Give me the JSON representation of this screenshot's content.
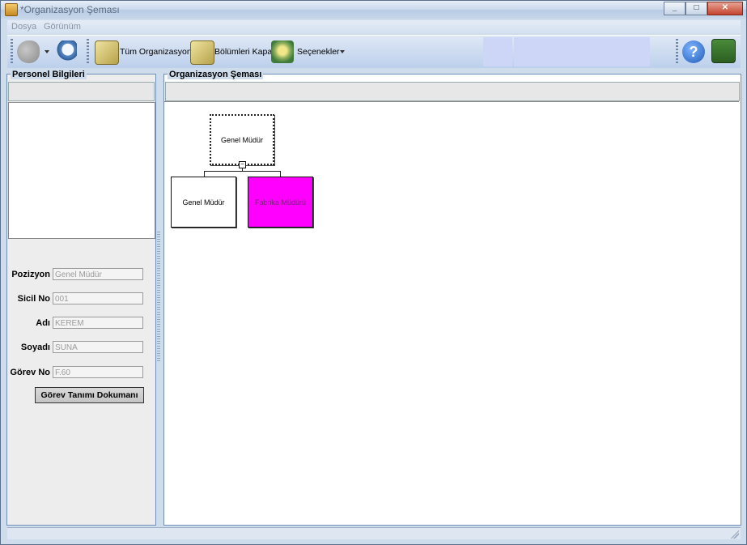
{
  "window": {
    "title": "*Organizasyon Şeması"
  },
  "menu": {
    "items": [
      "Dosya",
      "Görünüm"
    ]
  },
  "toolbar": {
    "all_org_label": "Tüm Organizasyon",
    "close_sections_label": "Bölümleri Kapat",
    "options_label": "Seçenekler"
  },
  "left_panel": {
    "title": "Personel Bilgileri",
    "fields": [
      {
        "label": "Pozizyon",
        "value": "Genel Müdür"
      },
      {
        "label": "Sicil No",
        "value": "001"
      },
      {
        "label": "Adı",
        "value": "KEREM"
      },
      {
        "label": "Soyadı",
        "value": "SUNA"
      },
      {
        "label": "Görev No",
        "value": "F.60"
      }
    ],
    "doc_button": "Görev Tanımı Dokumanı"
  },
  "right_panel": {
    "title": "Organizasyon Şeması",
    "nodes": [
      {
        "label": "Genel Müdür"
      },
      {
        "label": "Genel Müdür"
      },
      {
        "label": "Fabrika Müdürü"
      }
    ],
    "toggle": "−"
  },
  "colors": {
    "highlight_node": "#ff00ff"
  }
}
